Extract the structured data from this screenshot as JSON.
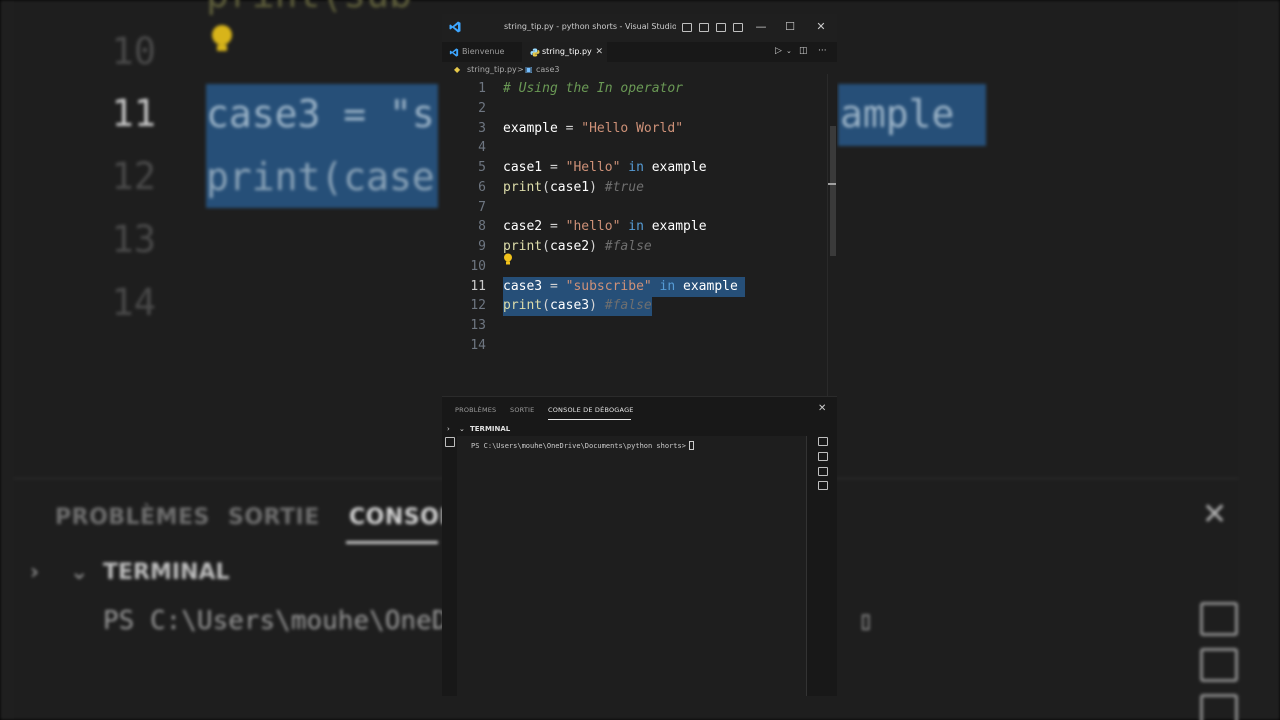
{
  "window": {
    "title": "string_tip.py - python shorts - Visual Studio Co...",
    "controls": {
      "minimize": "—",
      "maximize": "☐",
      "close": "✕"
    }
  },
  "tabs": [
    {
      "label": "Bienvenue",
      "active": false
    },
    {
      "label": "string_tip.py",
      "active": true,
      "close": "✕"
    }
  ],
  "breadcrumb": {
    "file": "string_tip.py",
    "separator": ">",
    "symbol": "case3"
  },
  "editor": {
    "lines": [
      {
        "number": "1",
        "tokens": [
          {
            "text": "# Using the In operator",
            "cls": "c-com"
          }
        ]
      },
      {
        "number": "2",
        "tokens": []
      },
      {
        "number": "3",
        "tokens": [
          {
            "text": "example",
            "cls": "c-var"
          },
          {
            "text": " = ",
            "cls": "c-op"
          },
          {
            "text": "\"Hello World\"",
            "cls": "c-str"
          }
        ]
      },
      {
        "number": "4",
        "tokens": []
      },
      {
        "number": "5",
        "tokens": [
          {
            "text": "case1",
            "cls": "c-var"
          },
          {
            "text": " = ",
            "cls": "c-op"
          },
          {
            "text": "\"Hello\"",
            "cls": "c-str"
          },
          {
            "text": " in ",
            "cls": "c-kw"
          },
          {
            "text": "example",
            "cls": "c-var"
          }
        ]
      },
      {
        "number": "6",
        "tokens": [
          {
            "text": "print",
            "cls": "c-fn"
          },
          {
            "text": "(",
            "cls": "c-op"
          },
          {
            "text": "case1",
            "cls": "c-var"
          },
          {
            "text": ") ",
            "cls": "c-op"
          },
          {
            "text": "#true",
            "cls": "c-com2"
          }
        ]
      },
      {
        "number": "7",
        "tokens": []
      },
      {
        "number": "8",
        "tokens": [
          {
            "text": "case2",
            "cls": "c-var"
          },
          {
            "text": " = ",
            "cls": "c-op"
          },
          {
            "text": "\"hello\"",
            "cls": "c-str"
          },
          {
            "text": " in ",
            "cls": "c-kw"
          },
          {
            "text": "example",
            "cls": "c-var"
          }
        ]
      },
      {
        "number": "9",
        "tokens": [
          {
            "text": "print",
            "cls": "c-fn"
          },
          {
            "text": "(",
            "cls": "c-op"
          },
          {
            "text": "case2",
            "cls": "c-var"
          },
          {
            "text": ") ",
            "cls": "c-op"
          },
          {
            "text": "#false",
            "cls": "c-com2"
          }
        ]
      },
      {
        "number": "10",
        "tokens": []
      },
      {
        "number": "11",
        "active": true,
        "selected": true,
        "tokens": [
          {
            "text": "case3",
            "cls": "c-var"
          },
          {
            "text": " = ",
            "cls": "c-op"
          },
          {
            "text": "\"subscribe\"",
            "cls": "c-str"
          },
          {
            "text": " in ",
            "cls": "c-kw"
          },
          {
            "text": "example ",
            "cls": "c-var"
          }
        ]
      },
      {
        "number": "12",
        "selected": true,
        "tokens": [
          {
            "text": "print",
            "cls": "c-fn"
          },
          {
            "text": "(",
            "cls": "c-op"
          },
          {
            "text": "case3",
            "cls": "c-var"
          },
          {
            "text": ") ",
            "cls": "c-op"
          },
          {
            "text": "#false",
            "cls": "c-com2"
          }
        ]
      },
      {
        "number": "13",
        "tokens": []
      },
      {
        "number": "14",
        "tokens": []
      }
    ]
  },
  "panel": {
    "tabs": [
      {
        "label": "PROBLÈMES",
        "active": false
      },
      {
        "label": "SORTIE",
        "active": false
      },
      {
        "label": "CONSOLE DE DÉBOGAGE",
        "active": true
      }
    ],
    "close": "✕",
    "terminal_title": "TERMINAL",
    "prompt": "PS C:\\Users\\mouhe\\OneDrive\\Documents\\python shorts>"
  },
  "background": {
    "line_numbers": [
      "10",
      "11",
      "12",
      "13",
      "14"
    ],
    "code_line_11": "case3 = \"s",
    "code_line_12": "print(case",
    "code_tail": "ample",
    "code_top": "print(sub",
    "panel_tabs": [
      "PROBLÈMES",
      "SORTIE",
      "CONSOL"
    ],
    "terminal_title": "TERMINAL",
    "terminal_line": "PS C:\\Users\\mouhe\\OneDr",
    "close": "✕"
  },
  "colors": {
    "selection": "#264f78",
    "string": "#ce9178",
    "keyword": "#569cd6",
    "function": "#dcdcaa",
    "comment": "#6a9955"
  }
}
